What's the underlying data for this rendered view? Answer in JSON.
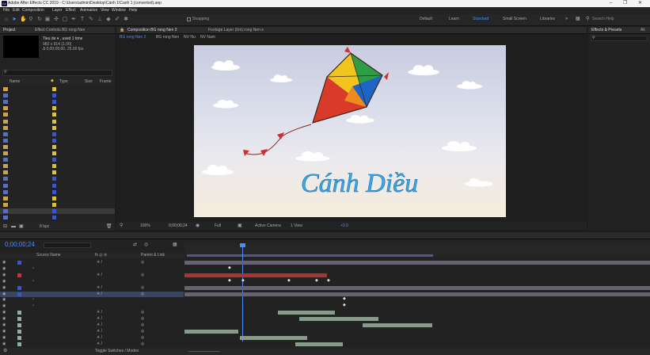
{
  "app": {
    "title": "Adobe After Effects CC 2019 - C:\\Users\\admin\\Desktop\\Cánh 1\\Canh 1 (converted).aep"
  },
  "window_controls": {
    "minimize": "–",
    "restore": "❐",
    "close": "✕"
  },
  "menu": [
    "File",
    "Edit",
    "Composition",
    "Layer",
    "Effect",
    "Animation",
    "View",
    "Window",
    "Help"
  ],
  "toolbar": {
    "snapping": "Snapping",
    "workspaces": [
      "Default",
      "Learn",
      "Standard",
      "Small Screen",
      "Libraries"
    ],
    "search": "Search Help"
  },
  "project": {
    "tab": "Project",
    "effect_tab": "Effect Controls BG rong Nen",
    "item_name": "Tieu de ▾ , used 1 time",
    "item_info1": "982 x 914 (1.00)",
    "item_info2": "Δ 0;00;05;00, 25.00 fps",
    "col_name": "Name",
    "col_type": "Type",
    "col_size": "Size",
    "col_frame": "Frame",
    "rows": [
      {
        "name": "Anh",
        "type": "Folder",
        "size": "",
        "color": "#d8c04a",
        "kind": "folder"
      },
      {
        "name": "BG rong Nen",
        "type": "Composition",
        "size": "25",
        "color": "#3d57c8",
        "kind": "comp"
      },
      {
        "name": "BG rong Nen 2",
        "type": "Composition",
        "size": "25",
        "color": "#3d57c8",
        "kind": "comp"
      },
      {
        "name": "BG rong...n Layers",
        "type": "Folder",
        "size": "",
        "color": "#d8c04a",
        "kind": "folder"
      },
      {
        "name": "Bia",
        "type": "Folder",
        "size": "",
        "color": "#d8c04a",
        "kind": "folder"
      },
      {
        "name": "BL",
        "type": "Folder",
        "size": "",
        "color": "#d8c04a",
        "kind": "folder"
      },
      {
        "name": "Solids",
        "type": "Folder",
        "size": "",
        "color": "#d8c04a",
        "kind": "folder"
      },
      {
        "name": "VN Nam",
        "type": "Composition",
        "size": "25",
        "color": "#3d57c8",
        "kind": "comp"
      },
      {
        "name": "Canh1",
        "type": "Composition",
        "size": "25",
        "color": "#3d57c8",
        "kind": "comp"
      },
      {
        "name": "Girl",
        "type": "Folder",
        "size": "",
        "color": "#d8c04a",
        "kind": "folder"
      },
      {
        "name": "BG",
        "type": "Folder",
        "size": "",
        "color": "#d8c04a",
        "kind": "folder"
      },
      {
        "name": "NV Nu",
        "type": "Composition",
        "size": "25",
        "color": "#3d57c8",
        "kind": "comp"
      },
      {
        "name": "Solids",
        "type": "Folder",
        "size": "",
        "color": "#d8c04a",
        "kind": "folder"
      },
      {
        "name": "NL",
        "type": "Folder",
        "size": "",
        "color": "#d8c04a",
        "kind": "folder"
      },
      {
        "name": "Pre-comp 1",
        "type": "Composition",
        "size": "25",
        "color": "#3d57c8",
        "kind": "comp"
      },
      {
        "name": "Thuyen NV BG",
        "type": "Composition",
        "size": "25",
        "color": "#3d57c8",
        "kind": "comp"
      },
      {
        "name": "Thuyen NV BG 2",
        "type": "Composition",
        "size": "25",
        "color": "#3d57c8",
        "kind": "comp"
      },
      {
        "name": "Thuyen ...2 Layers",
        "type": "Folder",
        "size": "",
        "color": "#d8c04a",
        "kind": "folder"
      },
      {
        "name": "Thuyen ...4 Layers",
        "type": "Folder",
        "size": "",
        "color": "#d8c04a",
        "kind": "folder"
      },
      {
        "name": "Tieu de",
        "type": "Composition",
        "size": "25",
        "color": "#3d57c8",
        "kind": "comp"
      },
      {
        "name": "Untitled 1",
        "type": "Composition",
        "size": "",
        "color": "#3d57c8",
        "kind": "comp"
      }
    ],
    "footer_bpc": "8 bpc"
  },
  "viewer": {
    "tabs": [
      "Composition BG rong Nen 2",
      "Footage Layer (tìm) rong Nen e"
    ],
    "breadcrumbs": [
      "BG rong Nen 2",
      "BG rong Nen",
      "NV Nu",
      "NV Nam"
    ],
    "title_text": "Cánh Diều",
    "zoom": "100%",
    "timecode": "0;00;00;24",
    "resolution": "Full",
    "camera": "Active Camera",
    "view": "1 View",
    "plus": "+0.0"
  },
  "effects": {
    "tab": "Effects & Presets",
    "tab2": "Ali",
    "items": [
      "* Animation Presets",
      "3D Channel",
      "Audio",
      "Blur & Sharpen",
      "Boris FX Mocha",
      "Channel",
      "CINEMA 4D",
      "Color Correction",
      "Distort",
      "Expression Controls",
      "Generate",
      "Immersive Video",
      "Keying",
      "Matte",
      "Missing",
      "Noise & Grain",
      "Obsolete",
      "Perspective",
      "Simulation",
      "Stylize",
      "Text",
      "Time",
      "Transition",
      "Utility"
    ]
  },
  "timeline": {
    "tabs": [
      "BG rong Nen 2",
      "BG rong Nen",
      "Paragraph",
      "Tieu de",
      "Canh1",
      "Thuyen NV BG",
      "NV Nu",
      "VN Nam"
    ],
    "timecode": "0;00;00;24",
    "col_source": "Source Name",
    "col_switches": "fx ◎ ⊘",
    "col_parent": "Parent & Link",
    "ruler": [
      "0:00s",
      "05s",
      "10s",
      "15s",
      "20s",
      "25s",
      "30s",
      "35s",
      "40s",
      "45s",
      "50s",
      "55s"
    ],
    "toggle_label": "Toggle Switches / Modes",
    "layers": [
      {
        "num": "1",
        "name": "[Tieu de]",
        "parent": "None",
        "color": "#3d57c8",
        "kind": "layer"
      },
      {
        "num": "",
        "name": "Position",
        "parent": "",
        "value": "482.0,360.0",
        "kind": "prop"
      },
      {
        "num": "2",
        "name": "[Black Solid 1]",
        "parent": "None",
        "color": "#c33",
        "kind": "layer"
      },
      {
        "num": "",
        "name": "Opacity",
        "parent": "",
        "value": "0 %",
        "kind": "prop"
      },
      {
        "num": "3",
        "name": "[Canh1]",
        "parent": "None",
        "color": "#3d57c8",
        "kind": "layer"
      },
      {
        "num": "4",
        "name": "[BG rong Nen]",
        "parent": "None",
        "color": "#3d57c8",
        "kind": "layer"
      },
      {
        "num": "",
        "name": "Position",
        "parent": "",
        "value": "482.0,373.0",
        "kind": "prop"
      },
      {
        "num": "",
        "name": "Scale",
        "parent": "",
        "value": "∞ 100.0,100.0 %",
        "kind": "prop"
      },
      {
        "num": "5",
        "name": "[I HATE...ough mp3]",
        "parent": "None",
        "color": "#9aa",
        "kind": "layer"
      },
      {
        "num": "6",
        "name": "[Tieng nuoc 2.mp3]",
        "parent": "None",
        "color": "#9aa",
        "kind": "layer"
      },
      {
        "num": "7",
        "name": "[Tieng nuoc 2.mp3]",
        "parent": "None",
        "color": "#9aa",
        "kind": "layer"
      },
      {
        "num": "8",
        "name": "[mo dau...2.mp3]",
        "parent": "None",
        "color": "#9aa",
        "kind": "layer"
      },
      {
        "num": "9",
        "name": "[mo dau...2.mp3]",
        "parent": "None",
        "color": "#9aa",
        "kind": "layer"
      },
      {
        "num": "10",
        "name": "[mo dau...2.mp3]",
        "parent": "None",
        "color": "#9aa",
        "kind": "layer"
      }
    ]
  }
}
